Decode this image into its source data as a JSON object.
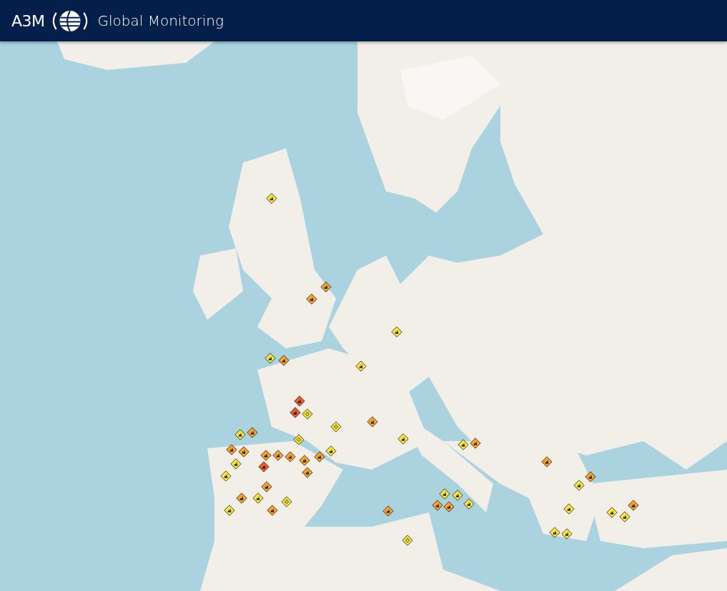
{
  "header": {
    "brand": "A3M",
    "title": "Global Monitoring"
  },
  "map": {
    "markers": [
      {
        "kind": "fire",
        "color": "#f7e43c"
      },
      {
        "kind": "fire",
        "color": "#f6a22a"
      },
      {
        "kind": "fire",
        "color": "#f6a22a"
      },
      {
        "kind": "fire",
        "color": "#f7e43c"
      },
      {
        "kind": "fire",
        "color": "#f6a22a"
      },
      {
        "kind": "fire",
        "color": "#f7e43c"
      },
      {
        "kind": "fire",
        "color": "#f7e43c"
      },
      {
        "kind": "heat",
        "color": "#f7e43c"
      },
      {
        "kind": "fire",
        "color": "#f05a28"
      },
      {
        "kind": "fire",
        "color": "#f05a28"
      },
      {
        "kind": "heat",
        "color": "#f7e43c"
      },
      {
        "kind": "fire",
        "color": "#f6a22a"
      },
      {
        "kind": "fire",
        "color": "#f7e43c"
      },
      {
        "kind": "fire",
        "color": "#f6a22a"
      },
      {
        "kind": "fire",
        "color": "#f6a22a"
      },
      {
        "kind": "fire",
        "color": "#f6a22a"
      },
      {
        "kind": "fire",
        "color": "#f7e43c"
      },
      {
        "kind": "fire",
        "color": "#f6a22a"
      },
      {
        "kind": "fire",
        "color": "#f6a22a"
      },
      {
        "kind": "fire",
        "color": "#f6a22a"
      },
      {
        "kind": "fire",
        "color": "#f6a22a"
      },
      {
        "kind": "fire",
        "color": "#f05a28"
      },
      {
        "kind": "heat",
        "color": "#f7e43c"
      },
      {
        "kind": "fire",
        "color": "#f7e43c"
      },
      {
        "kind": "fire",
        "color": "#f6a22a"
      },
      {
        "kind": "fire",
        "color": "#f7e43c"
      },
      {
        "kind": "fire",
        "color": "#f6a22a"
      },
      {
        "kind": "fire",
        "color": "#f6a22a"
      },
      {
        "kind": "fire",
        "color": "#f7e43c"
      },
      {
        "kind": "fire",
        "color": "#f6a22a"
      },
      {
        "kind": "fire",
        "color": "#f7e43c"
      },
      {
        "kind": "fire",
        "color": "#f6a22a"
      },
      {
        "kind": "heat",
        "color": "#f7e43c"
      },
      {
        "kind": "fire",
        "color": "#f7e43c"
      },
      {
        "kind": "fire",
        "color": "#f7e43c"
      },
      {
        "kind": "fire",
        "color": "#f6a22a"
      },
      {
        "kind": "fire",
        "color": "#f6a22a"
      },
      {
        "kind": "heat",
        "color": "#f7e43c"
      },
      {
        "kind": "fire",
        "color": "#f7e43c"
      },
      {
        "kind": "fire",
        "color": "#f6a22a"
      },
      {
        "kind": "fire",
        "color": "#f7e43c"
      },
      {
        "kind": "fire",
        "color": "#f7e43c"
      },
      {
        "kind": "fire",
        "color": "#f6a22a"
      },
      {
        "kind": "fire",
        "color": "#f6a22a"
      },
      {
        "kind": "fire",
        "color": "#f7e43c"
      },
      {
        "kind": "fire",
        "color": "#f7e43c"
      },
      {
        "kind": "fire",
        "color": "#f7e43c"
      },
      {
        "kind": "fire",
        "color": "#f6a22a"
      },
      {
        "kind": "fire",
        "color": "#f7e43c"
      },
      {
        "kind": "fire",
        "color": "#f7e43c"
      },
      {
        "kind": "fire",
        "color": "#f7e43c"
      },
      {
        "kind": "fire",
        "color": "#f6a22a"
      }
    ]
  }
}
